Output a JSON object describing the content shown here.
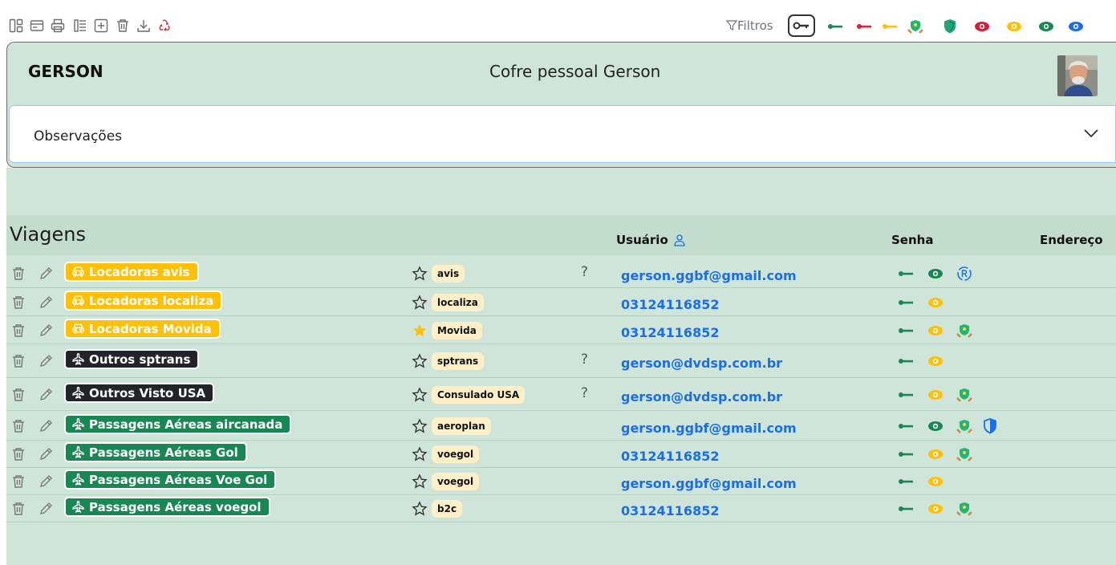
{
  "toolbar": {
    "icons": [
      "layout-icon",
      "card-icon",
      "printer-icon",
      "list-icon",
      "add-icon",
      "trash-icon",
      "download-icon",
      "recycle-icon"
    ],
    "filters_label": "Filtros",
    "filter_icons": [
      "key-icon",
      "key-green-icon",
      "key-red-icon",
      "key-yellow-icon",
      "shield-hands-icon",
      "shield-green-icon",
      "eye-red-icon",
      "eye-yellow-icon",
      "eye-green-icon",
      "eye-blue-icon"
    ]
  },
  "header": {
    "name": "GERSON",
    "title": "Cofre pessoal Gerson"
  },
  "observations": {
    "label": "Observações"
  },
  "section": {
    "title": "Viagens",
    "col_user": "Usuário",
    "col_password": "Senha",
    "col_address": "Endereço"
  },
  "rows": [
    {
      "category": "Locadoras avis",
      "tag": "avis",
      "user": "gerson.ggbf@gmail.com",
      "q": "?"
    },
    {
      "category": "Locadoras localiza",
      "tag": "localiza",
      "user": "03124116852",
      "q": ""
    },
    {
      "category": "Locadoras Movida",
      "tag": "Movida",
      "user": "03124116852",
      "q": ""
    },
    {
      "category": "Outros sptrans",
      "tag": "sptrans",
      "user": "gerson@dvdsp.com.br",
      "q": "?"
    },
    {
      "category": "Outros Visto USA",
      "tag": "Consulado USA",
      "user": "gerson@dvdsp.com.br",
      "q": "?"
    },
    {
      "category": "Passagens Aéreas aircanada",
      "tag": "aeroplan",
      "user": "gerson.ggbf@gmail.com",
      "q": ""
    },
    {
      "category": "Passagens Aéreas Gol",
      "tag": "voegol",
      "user": "03124116852",
      "q": ""
    },
    {
      "category": "Passagens Aéreas Voe Gol",
      "tag": "voegol",
      "user": "gerson.ggbf@gmail.com",
      "q": ""
    },
    {
      "category": "Passagens Aéreas voegol",
      "tag": "b2c",
      "user": "03124116852",
      "q": ""
    }
  ],
  "colors": {
    "panel_bg": "#cfe5da",
    "yellow": "#ffc107",
    "black": "#212529",
    "green": "#198754",
    "link_blue": "#1a6ee8"
  }
}
